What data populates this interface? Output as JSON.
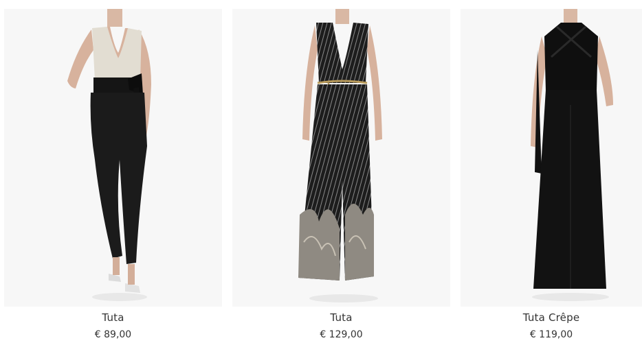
{
  "products": [
    {
      "name": "Tuta",
      "price": "€ 89,00",
      "image": "black-and-cream-wrap-jumpsuit-photo"
    },
    {
      "name": "Tuta",
      "price": "€ 129,00",
      "image": "pinstripe-paisley-wide-leg-jumpsuit-photo"
    },
    {
      "name": "Tuta Crêpe",
      "price": "€ 119,00",
      "image": "black-halter-crepe-jumpsuit-photo"
    }
  ]
}
